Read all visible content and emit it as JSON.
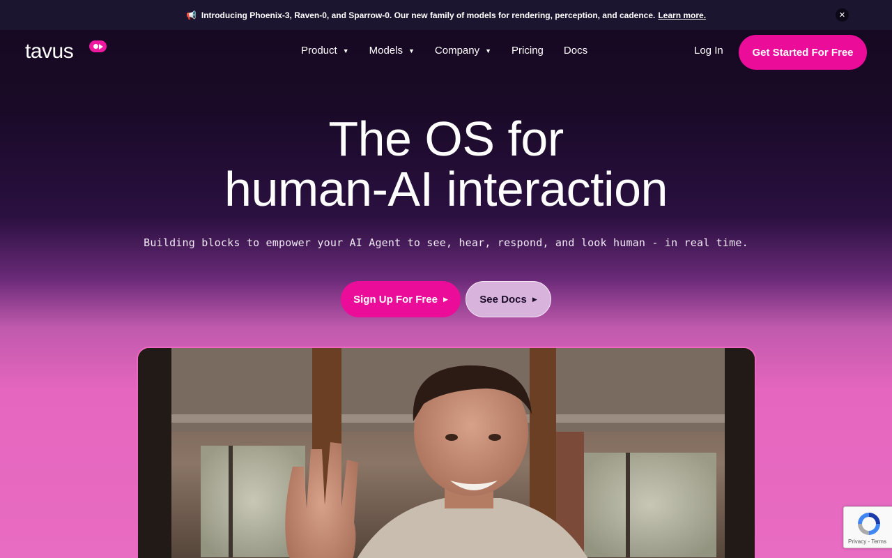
{
  "announcement": {
    "icon": "megaphone-icon",
    "text": "Introducing Phoenix-3, Raven-0, and Sparrow-0. Our new family of models for rendering, perception, and cadence.",
    "link": "Learn more.",
    "close": "✕"
  },
  "nav": {
    "logo": "tavus",
    "items": [
      {
        "label": "Product",
        "caret": "▼"
      },
      {
        "label": "Models",
        "caret": "▼"
      },
      {
        "label": "Company",
        "caret": "▼"
      },
      {
        "label": "Pricing",
        "caret": ""
      },
      {
        "label": "Docs",
        "caret": ""
      }
    ],
    "login": "Log In",
    "cta": "Get Started For Free"
  },
  "hero": {
    "title_line1": "The OS for",
    "title_line2": "human-AI interaction",
    "subtitle": "Building blocks to empower your AI Agent to see, hear, respond, and look human - in real time.",
    "primary_button": "Sign Up For Free",
    "secondary_button": "See Docs",
    "arrow": "▶"
  },
  "recaptcha": {
    "terms": "Privacy - Terms"
  },
  "colors": {
    "accent": "#ec0c9a",
    "background_dark": "#15081f",
    "background_pink": "#e86cc2"
  }
}
